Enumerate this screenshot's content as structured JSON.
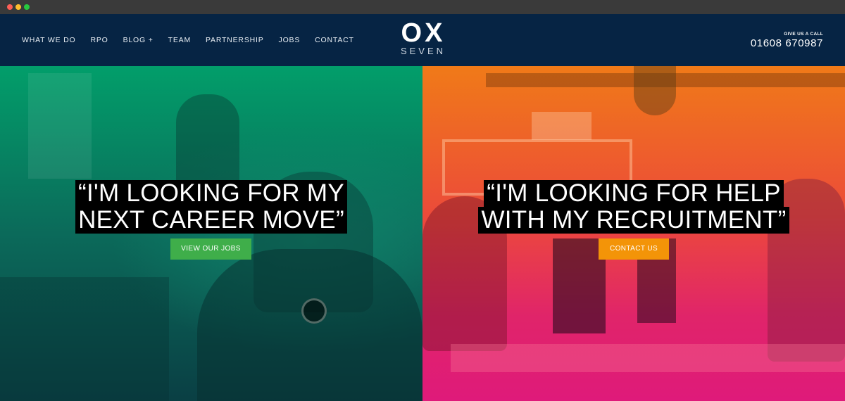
{
  "header": {
    "nav": [
      "WHAT WE DO",
      "RPO",
      "BLOG +",
      "TEAM",
      "PARTNERSHIP",
      "JOBS",
      "CONTACT"
    ],
    "logo": {
      "top": "OX",
      "bottom": "SEVEN"
    },
    "call": {
      "label": "GIVE US A CALL",
      "number": "01608 670987"
    }
  },
  "hero": {
    "left": {
      "quote_lines": [
        "“I'M LOOKING FOR MY",
        "NEXT CAREER MOVE”"
      ],
      "button": "VIEW OUR JOBS"
    },
    "right": {
      "quote_lines": [
        "“I'M LOOKING FOR HELP",
        "WITH MY RECRUITMENT”"
      ],
      "button": "CONTACT US"
    }
  },
  "colors": {
    "header_bg": "#062444",
    "green_button": "#3fae4a",
    "orange_button": "#f39408"
  }
}
